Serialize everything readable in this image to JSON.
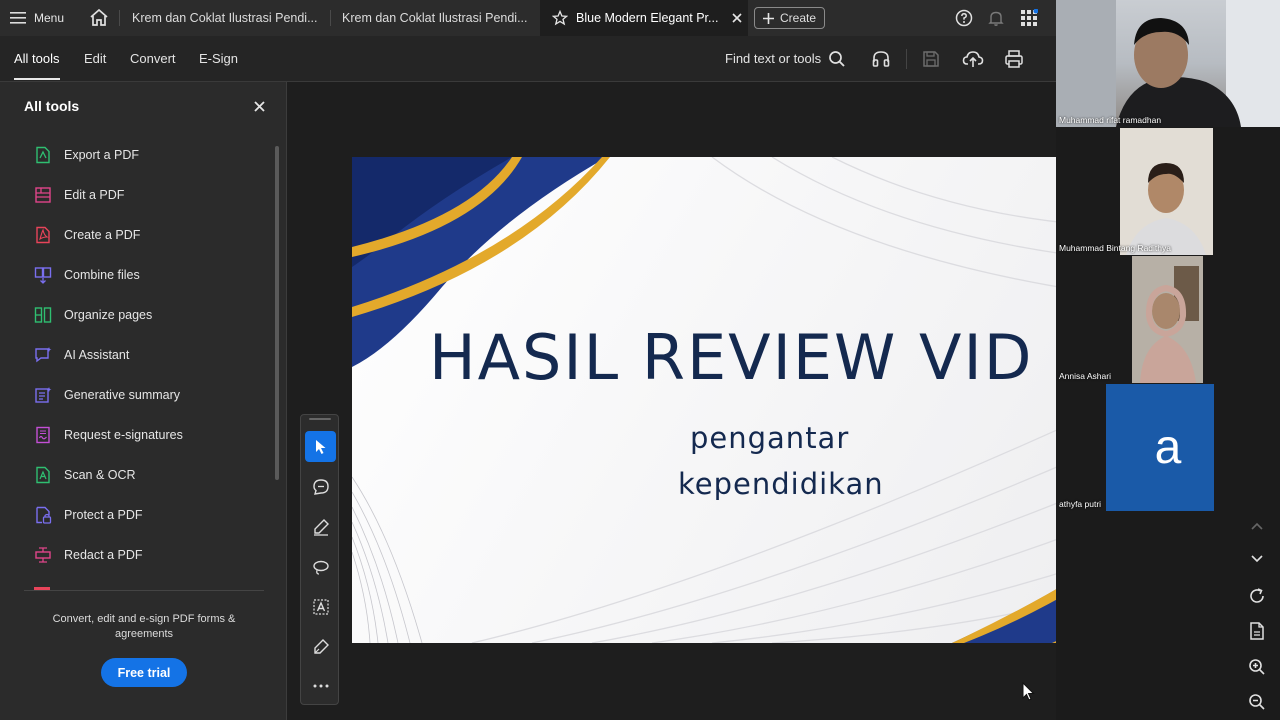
{
  "tabbar": {
    "menu_label": "Menu",
    "tabs": [
      {
        "label": "Krem dan Coklat Ilustrasi Pendi..."
      },
      {
        "label": "Krem dan Coklat Ilustrasi Pendi..."
      },
      {
        "label": "Blue Modern Elegant Pr..."
      }
    ],
    "create_label": "Create"
  },
  "toolbar": {
    "menu": [
      "All tools",
      "Edit",
      "Convert",
      "E-Sign"
    ],
    "find_label": "Find text or tools"
  },
  "sidebar": {
    "title": "All tools",
    "tools": [
      {
        "label": "Export a PDF",
        "icon": "export-pdf-icon",
        "color": "#2fbf71"
      },
      {
        "label": "Edit a PDF",
        "icon": "edit-pdf-icon",
        "color": "#e0458a"
      },
      {
        "label": "Create a PDF",
        "icon": "create-pdf-icon",
        "color": "#e8445a"
      },
      {
        "label": "Combine files",
        "icon": "combine-files-icon",
        "color": "#7a6ff0"
      },
      {
        "label": "Organize pages",
        "icon": "organize-pages-icon",
        "color": "#2fbf71"
      },
      {
        "label": "AI Assistant",
        "icon": "ai-assistant-icon",
        "color": "#7a6ff0"
      },
      {
        "label": "Generative summary",
        "icon": "generative-summary-icon",
        "color": "#7a6ff0"
      },
      {
        "label": "Request e-signatures",
        "icon": "request-esignatures-icon",
        "color": "#c44fd6"
      },
      {
        "label": "Scan & OCR",
        "icon": "scan-ocr-icon",
        "color": "#2fbf71"
      },
      {
        "label": "Protect a PDF",
        "icon": "protect-pdf-icon",
        "color": "#7a6ff0"
      },
      {
        "label": "Redact a PDF",
        "icon": "redact-pdf-icon",
        "color": "#e0458a"
      }
    ],
    "promo_text": "Convert, edit and e-sign PDF forms & agreements",
    "free_trial_label": "Free trial"
  },
  "slide": {
    "title": "HASIL REVIEW VID",
    "subtitle_line1": "pengantar",
    "subtitle_line2": "kependidikan",
    "accent_navy": "#1f3a8a",
    "accent_gold": "#e3a92b"
  },
  "participants": [
    {
      "name": "Muhammad rifat ramadhan"
    },
    {
      "name": "Muhammad Bintang Radithya"
    },
    {
      "name": "Annisa Ashari"
    },
    {
      "name": "athyfa putri",
      "avatar_letter": "a",
      "avatar_color": "#1a5aa8"
    }
  ],
  "colors": {
    "accent_blue": "#1473e6",
    "app_bg": "#1e1e1e"
  }
}
